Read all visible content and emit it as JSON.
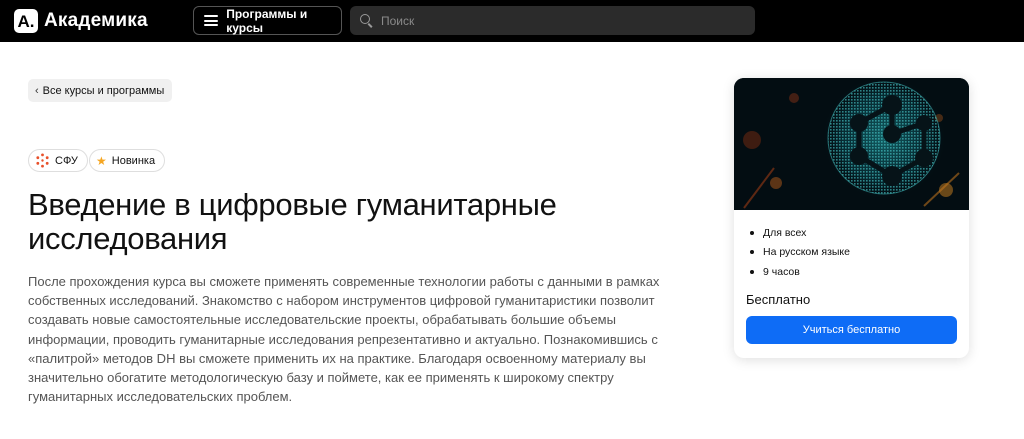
{
  "header": {
    "logo_mark": "A.",
    "logo_text": "Академика",
    "programs_label": "Программы и курсы",
    "search_placeholder": "Поиск",
    "search_value": ""
  },
  "breadcrumb": {
    "back_label": "Все курсы и программы"
  },
  "badges": [
    {
      "label": "СФУ",
      "icon": "sfu-logo-icon"
    },
    {
      "label": "Новинка",
      "icon": "star-icon"
    }
  ],
  "course": {
    "title": "Введение в цифровые гуманитарные исследования",
    "description": "После прохождения курса вы сможете применять современные технологии работы с данными в рамках собственных исследований. Знакомство с набором инструментов цифровой гуманитаристики позволит создавать новые самостоятельные исследовательские проекты, обрабатывать большие объемы информации, проводить гуманитарные исследования репрезентативно и актуально. Познакомившись с «палитрой» методов DH вы сможете применить их на практике. Благодаря освоенному материалу вы значительно обогатите методологическую базу и поймете, как ее применять к широкому спектру гуманитарных исследовательских проблем."
  },
  "card": {
    "features": [
      "Для всех",
      "На русском языке",
      "9 часов"
    ],
    "price": "Бесплатно",
    "cta_label": "Учиться бесплатно"
  },
  "colors": {
    "header_bg": "#000000",
    "search_bg": "#2b2b2b",
    "accent": "#0e6cf6",
    "star": "#f5a623",
    "sfu_logo": "#e8502a",
    "chip_bg": "#f0f0f0",
    "network_glow": "#1fa3a8"
  }
}
